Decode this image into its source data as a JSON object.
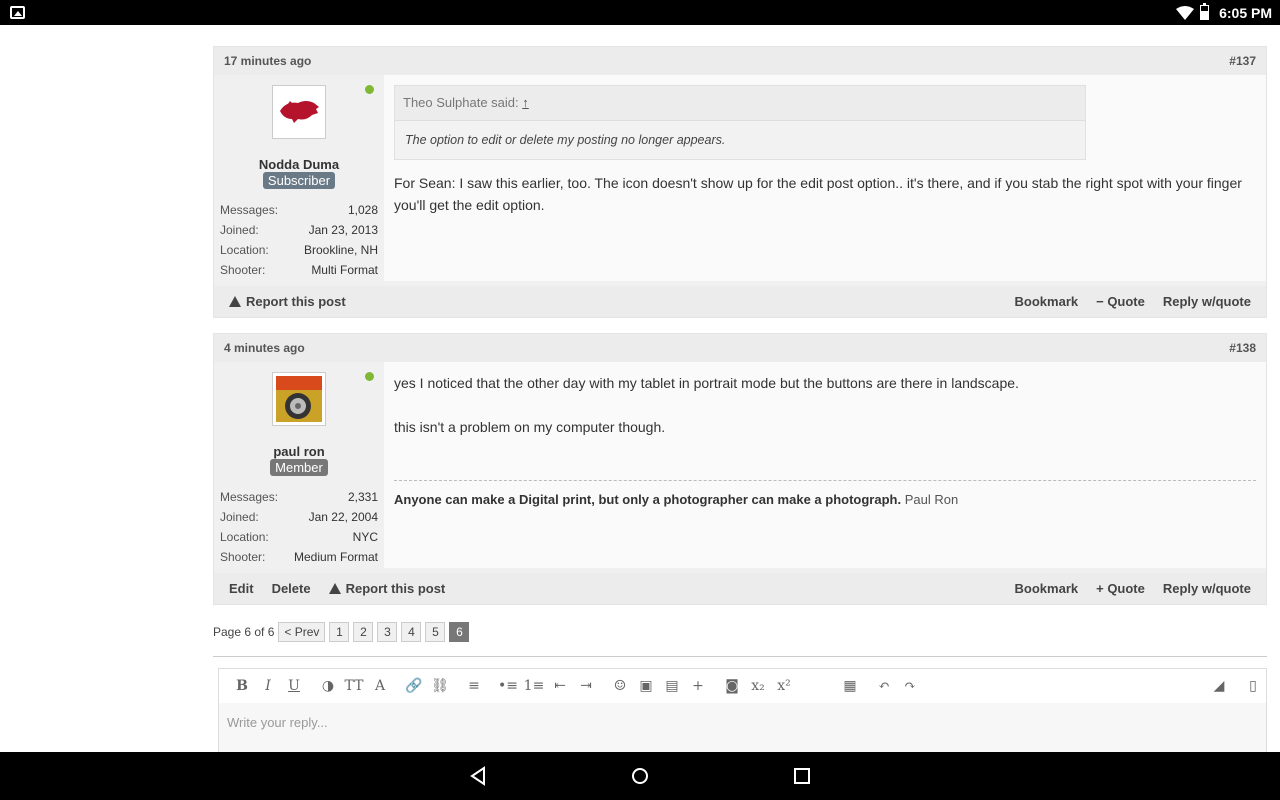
{
  "status": {
    "time": "6:05 PM"
  },
  "posts": [
    {
      "time": "17 minutes ago",
      "number": "#137",
      "username": "Nodda Duma",
      "role": "Subscriber",
      "stats": [
        {
          "label": "Messages:",
          "value": "1,028"
        },
        {
          "label": "Joined:",
          "value": "Jan 23, 2013"
        },
        {
          "label": "Location:",
          "value": "Brookline, NH"
        },
        {
          "label": "Shooter:",
          "value": "Multi Format"
        }
      ],
      "quote_author": "Theo Sulphate said:",
      "quote_link": "↑",
      "quote_text": "The option to edit or delete my posting no longer appears.",
      "body": "For Sean: I saw this earlier, too. The icon doesn't show up for the edit post option.. it's there, and if you stab the right spot with your finger you'll get the edit option.",
      "footer": {
        "report": "Report this post",
        "bookmark": "Bookmark",
        "quote": "− Quote",
        "reply": "Reply w/quote"
      }
    },
    {
      "time": "4 minutes ago",
      "number": "#138",
      "username": "paul ron",
      "role": "Member",
      "stats": [
        {
          "label": "Messages:",
          "value": "2,331"
        },
        {
          "label": "Joined:",
          "value": "Jan 22, 2004"
        },
        {
          "label": "Location:",
          "value": "NYC"
        },
        {
          "label": "Shooter:",
          "value": "Medium Format"
        }
      ],
      "body1": "yes I noticed that the other day with my tablet in portrait mode but the buttons are there in landscape.",
      "body2": "this isn't a problem on my computer though.",
      "sig_bold": "Anyone can make a Digital print, but only a photographer can make a photograph.",
      "sig_name": "Paul Ron",
      "footer": {
        "edit": "Edit",
        "delete": "Delete",
        "report": "Report this post",
        "bookmark": "Bookmark",
        "quote": "+ Quote",
        "reply": "Reply w/quote"
      }
    }
  ],
  "pager": {
    "label": "Page 6 of 6",
    "prev": "< Prev",
    "pages": [
      "1",
      "2",
      "3",
      "4",
      "5",
      "6"
    ]
  },
  "editor": {
    "placeholder": "Write your reply...",
    "tools": [
      "B",
      "I",
      "U",
      "◑",
      "TT",
      "A",
      "🔗",
      "⛓",
      "≡",
      "•≡",
      "1≡",
      "⇤",
      "⇥",
      "☺",
      "▣",
      "▤",
      "+",
      "◙",
      "x₂",
      "x²",
      "▦",
      "↶",
      "↷"
    ]
  }
}
